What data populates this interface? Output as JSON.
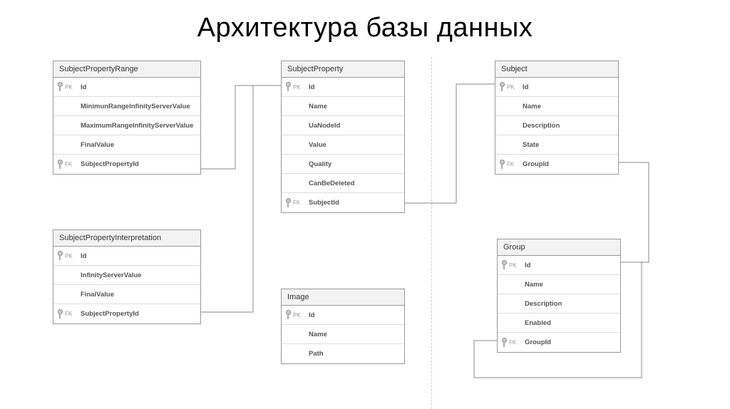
{
  "title": "Архитектура базы данных",
  "tables": {
    "subjectPropertyRange": {
      "name": "SubjectPropertyRange",
      "fields": [
        {
          "key": "PK",
          "name": "Id"
        },
        {
          "key": "",
          "name": "MinimunRangeInfinityServerValue"
        },
        {
          "key": "",
          "name": "MaximumRangeInfinityServerValue"
        },
        {
          "key": "",
          "name": "FinalValue"
        },
        {
          "key": "FK",
          "name": "SubjectPropertyId"
        }
      ]
    },
    "subjectProperty": {
      "name": "SubjectProperty",
      "fields": [
        {
          "key": "PK",
          "name": "Id"
        },
        {
          "key": "",
          "name": "Name"
        },
        {
          "key": "",
          "name": "UaNodeId"
        },
        {
          "key": "",
          "name": "Value"
        },
        {
          "key": "",
          "name": "Quality"
        },
        {
          "key": "",
          "name": "CanBeDeleted"
        },
        {
          "key": "FK",
          "name": "SubjectId"
        }
      ]
    },
    "subject": {
      "name": "Subject",
      "fields": [
        {
          "key": "PK",
          "name": "Id"
        },
        {
          "key": "",
          "name": "Name"
        },
        {
          "key": "",
          "name": "Description"
        },
        {
          "key": "",
          "name": "State"
        },
        {
          "key": "FK",
          "name": "GroupId"
        }
      ]
    },
    "subjectPropertyInterpretation": {
      "name": "SubjectPropertyInterpretation",
      "fields": [
        {
          "key": "PK",
          "name": "Id"
        },
        {
          "key": "",
          "name": "InfinityServerValue"
        },
        {
          "key": "",
          "name": "FinalValue"
        },
        {
          "key": "FK",
          "name": "SubjectPropertyId"
        }
      ]
    },
    "image": {
      "name": "Image",
      "fields": [
        {
          "key": "PK",
          "name": "Id"
        },
        {
          "key": "",
          "name": "Name"
        },
        {
          "key": "",
          "name": "Path"
        }
      ]
    },
    "group": {
      "name": "Group",
      "fields": [
        {
          "key": "PK",
          "name": "Id"
        },
        {
          "key": "",
          "name": "Name"
        },
        {
          "key": "",
          "name": "Description"
        },
        {
          "key": "",
          "name": "Enabled"
        },
        {
          "key": "FK",
          "name": "GroupId"
        }
      ]
    }
  }
}
